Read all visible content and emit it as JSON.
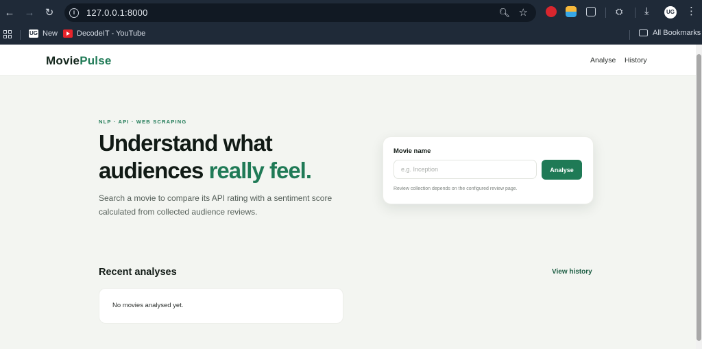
{
  "browser": {
    "url": "127.0.0.1:8000",
    "bookmarks": [
      {
        "label": "New"
      },
      {
        "label": "DecodeIT - YouTube"
      }
    ],
    "all_bookmarks": "All Bookmarks"
  },
  "header": {
    "logo_main": "Movie",
    "logo_accent": "Pulse",
    "nav": [
      {
        "label": "Analyse"
      },
      {
        "label": "History"
      }
    ]
  },
  "hero": {
    "eyebrow": "NLP · API · WEB SCRAPING",
    "title_line1": "Understand what",
    "title_line2_plain": "audiences ",
    "title_line2_accent": "really feel.",
    "subtitle": "Search a movie to compare its API rating with a sentiment score calculated from collected audience reviews."
  },
  "search": {
    "label": "Movie name",
    "placeholder": "e.g. Inception",
    "value": "",
    "button": "Analyse",
    "note": "Review collection depends on the configured review page."
  },
  "recent": {
    "title": "Recent analyses",
    "view_history": "View history",
    "empty": "No movies analysed yet."
  },
  "colors": {
    "accent": "#1f7a56",
    "browser_chrome": "#1f2a38",
    "page_background": "#f3f5f1"
  }
}
